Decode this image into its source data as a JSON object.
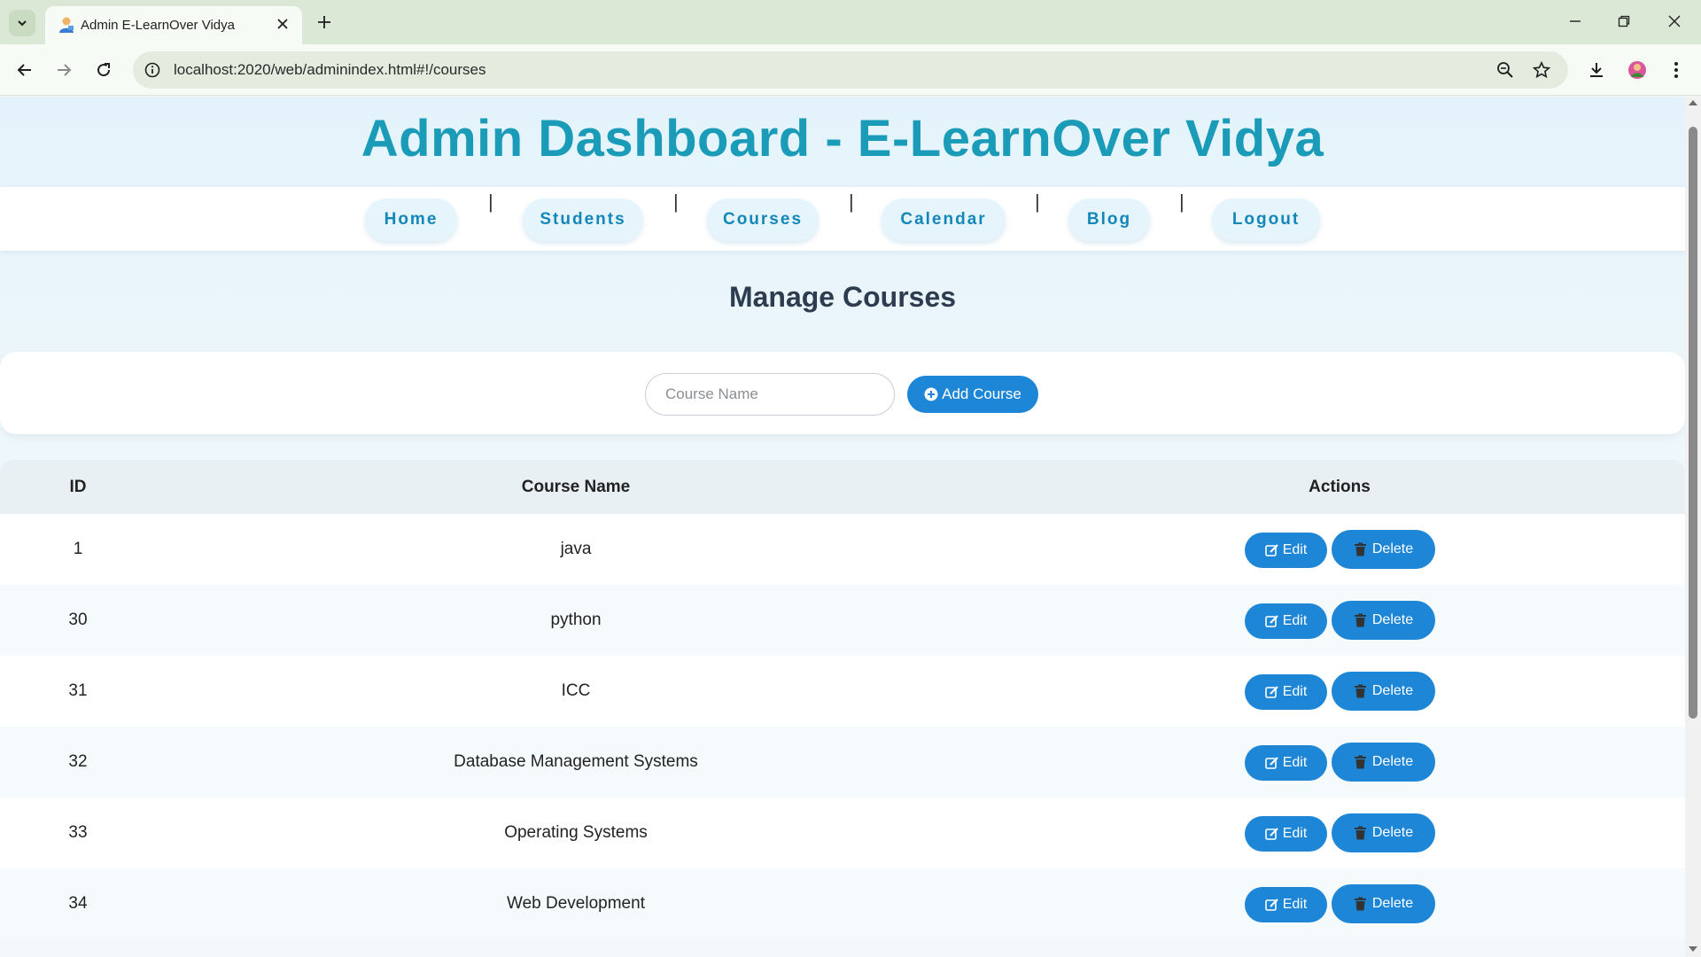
{
  "browser": {
    "tab_title": "Admin E-LearnOver Vidya",
    "url": "localhost:2020/web/adminindex.html#!/courses",
    "icons": {
      "tab_search": "chevron-down-icon",
      "new_tab": "plus-icon",
      "back": "back-arrow-icon",
      "forward": "forward-arrow-icon",
      "reload": "reload-icon",
      "site_info": "info-icon",
      "zoom": "zoom-icon",
      "bookmark": "star-icon",
      "downloads": "download-icon",
      "profile": "avatar",
      "menu": "kebab-menu-icon"
    }
  },
  "header": {
    "title": "Admin Dashboard - E-LearnOver Vidya"
  },
  "nav": {
    "items": [
      {
        "label": "Home"
      },
      {
        "label": "Students"
      },
      {
        "label": "Courses"
      },
      {
        "label": "Calendar"
      },
      {
        "label": "Blog"
      },
      {
        "label": "Logout"
      }
    ],
    "separator": "|"
  },
  "main": {
    "section_title": "Manage Courses",
    "add_form": {
      "input_placeholder": "Course Name",
      "input_value": "",
      "add_button_label": "Add Course"
    },
    "table": {
      "headers": [
        "ID",
        "Course Name",
        "Actions"
      ],
      "edit_label": "Edit",
      "delete_label": "Delete",
      "rows": [
        {
          "id": "1",
          "name": "java"
        },
        {
          "id": "30",
          "name": "python"
        },
        {
          "id": "31",
          "name": "ICC"
        },
        {
          "id": "32",
          "name": "Database Management Systems"
        },
        {
          "id": "33",
          "name": "Operating Systems"
        },
        {
          "id": "34",
          "name": "Web Development"
        }
      ]
    }
  },
  "colors": {
    "title": "#1a9bb8",
    "nav_text": "#1387b9",
    "button": "#1e86d6",
    "browser_frame": "#dce8d6"
  }
}
